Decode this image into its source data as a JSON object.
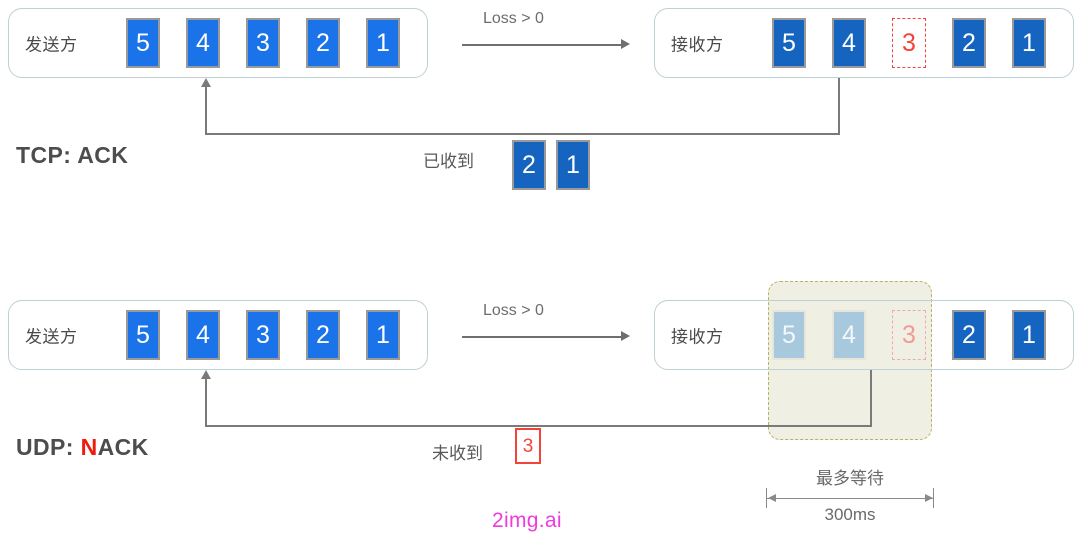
{
  "diagram": {
    "title_tcp": "TCP: ACK",
    "title_udp_prefix": "UDP: ",
    "title_udp_accent": "N",
    "title_udp_rest": "ACK",
    "sender_label": "发送方",
    "receiver_label": "接收方",
    "loss_label": "Loss > 0",
    "ack_text": "已收到",
    "nack_text": "未收到",
    "wait_label_line1": "最多等待",
    "wait_label_line2": "300ms",
    "watermark": "2img.ai"
  },
  "tcp_row": {
    "sender_packets": [
      "5",
      "4",
      "3",
      "2",
      "1"
    ],
    "receiver_packets": [
      {
        "value": "5",
        "state": "received"
      },
      {
        "value": "4",
        "state": "received"
      },
      {
        "value": "3",
        "state": "lost"
      },
      {
        "value": "2",
        "state": "received"
      },
      {
        "value": "1",
        "state": "received"
      }
    ],
    "ack_packets": [
      "2",
      "1"
    ]
  },
  "udp_row": {
    "sender_packets": [
      "5",
      "4",
      "3",
      "2",
      "1"
    ],
    "receiver_packets": [
      {
        "value": "5",
        "state": "buffered"
      },
      {
        "value": "4",
        "state": "buffered"
      },
      {
        "value": "3",
        "state": "lost-buffered"
      },
      {
        "value": "2",
        "state": "received"
      },
      {
        "value": "1",
        "state": "received"
      }
    ],
    "nack_packets": [
      "3"
    ]
  },
  "colors": {
    "sender_blue": "#1a73e8",
    "receiver_blue": "#1565c0",
    "faded_blue": "#a8c8de",
    "lost_red": "#f4433a",
    "accent_red": "#ee1b11",
    "wait_fill": "#f0efe4",
    "wait_border": "#b5b560",
    "container_border": "#bdd0d6",
    "line_gray": "#7a7a7a",
    "watermark": "#f03ae0"
  }
}
